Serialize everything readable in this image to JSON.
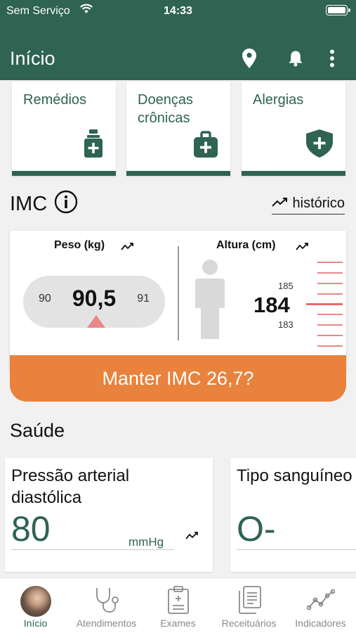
{
  "status": {
    "carrier": "Sem Serviço",
    "time": "14:33"
  },
  "header": {
    "title": "Início",
    "icons": [
      "location-pin-icon",
      "bell-icon",
      "more-vertical-icon"
    ]
  },
  "quick_cards": [
    {
      "label": "Remédios",
      "icon": "medicine-bottle-icon"
    },
    {
      "label": "Doenças crônicas",
      "icon": "first-aid-kit-icon"
    },
    {
      "label": "Alergias",
      "icon": "shield-plus-icon"
    }
  ],
  "imc": {
    "title": "IMC",
    "historico_label": "histórico",
    "peso": {
      "label": "Peso (kg)",
      "value": "90,5",
      "prev": "90",
      "next": "91"
    },
    "altura": {
      "label": "Altura (cm)",
      "value": "184",
      "prev": "185",
      "next": "183"
    },
    "button_label": "Manter IMC 26,7?"
  },
  "saude": {
    "title": "Saúde",
    "cards": [
      {
        "title": "Pressão arterial diastólica",
        "value": "80",
        "unit": "mmHg"
      },
      {
        "title": "Tipo sanguíneo",
        "value": "O-"
      }
    ]
  },
  "nav": [
    {
      "label": "Início",
      "icon": "avatar",
      "active": true
    },
    {
      "label": "Atendimentos",
      "icon": "stethoscope-icon"
    },
    {
      "label": "Exames",
      "icon": "clipboard-icon"
    },
    {
      "label": "Receituários",
      "icon": "documents-icon"
    },
    {
      "label": "Indicadores",
      "icon": "line-chart-icon"
    }
  ],
  "colors": {
    "primary": "#2f6352",
    "accent": "#e8823c",
    "marker": "#e88888"
  }
}
